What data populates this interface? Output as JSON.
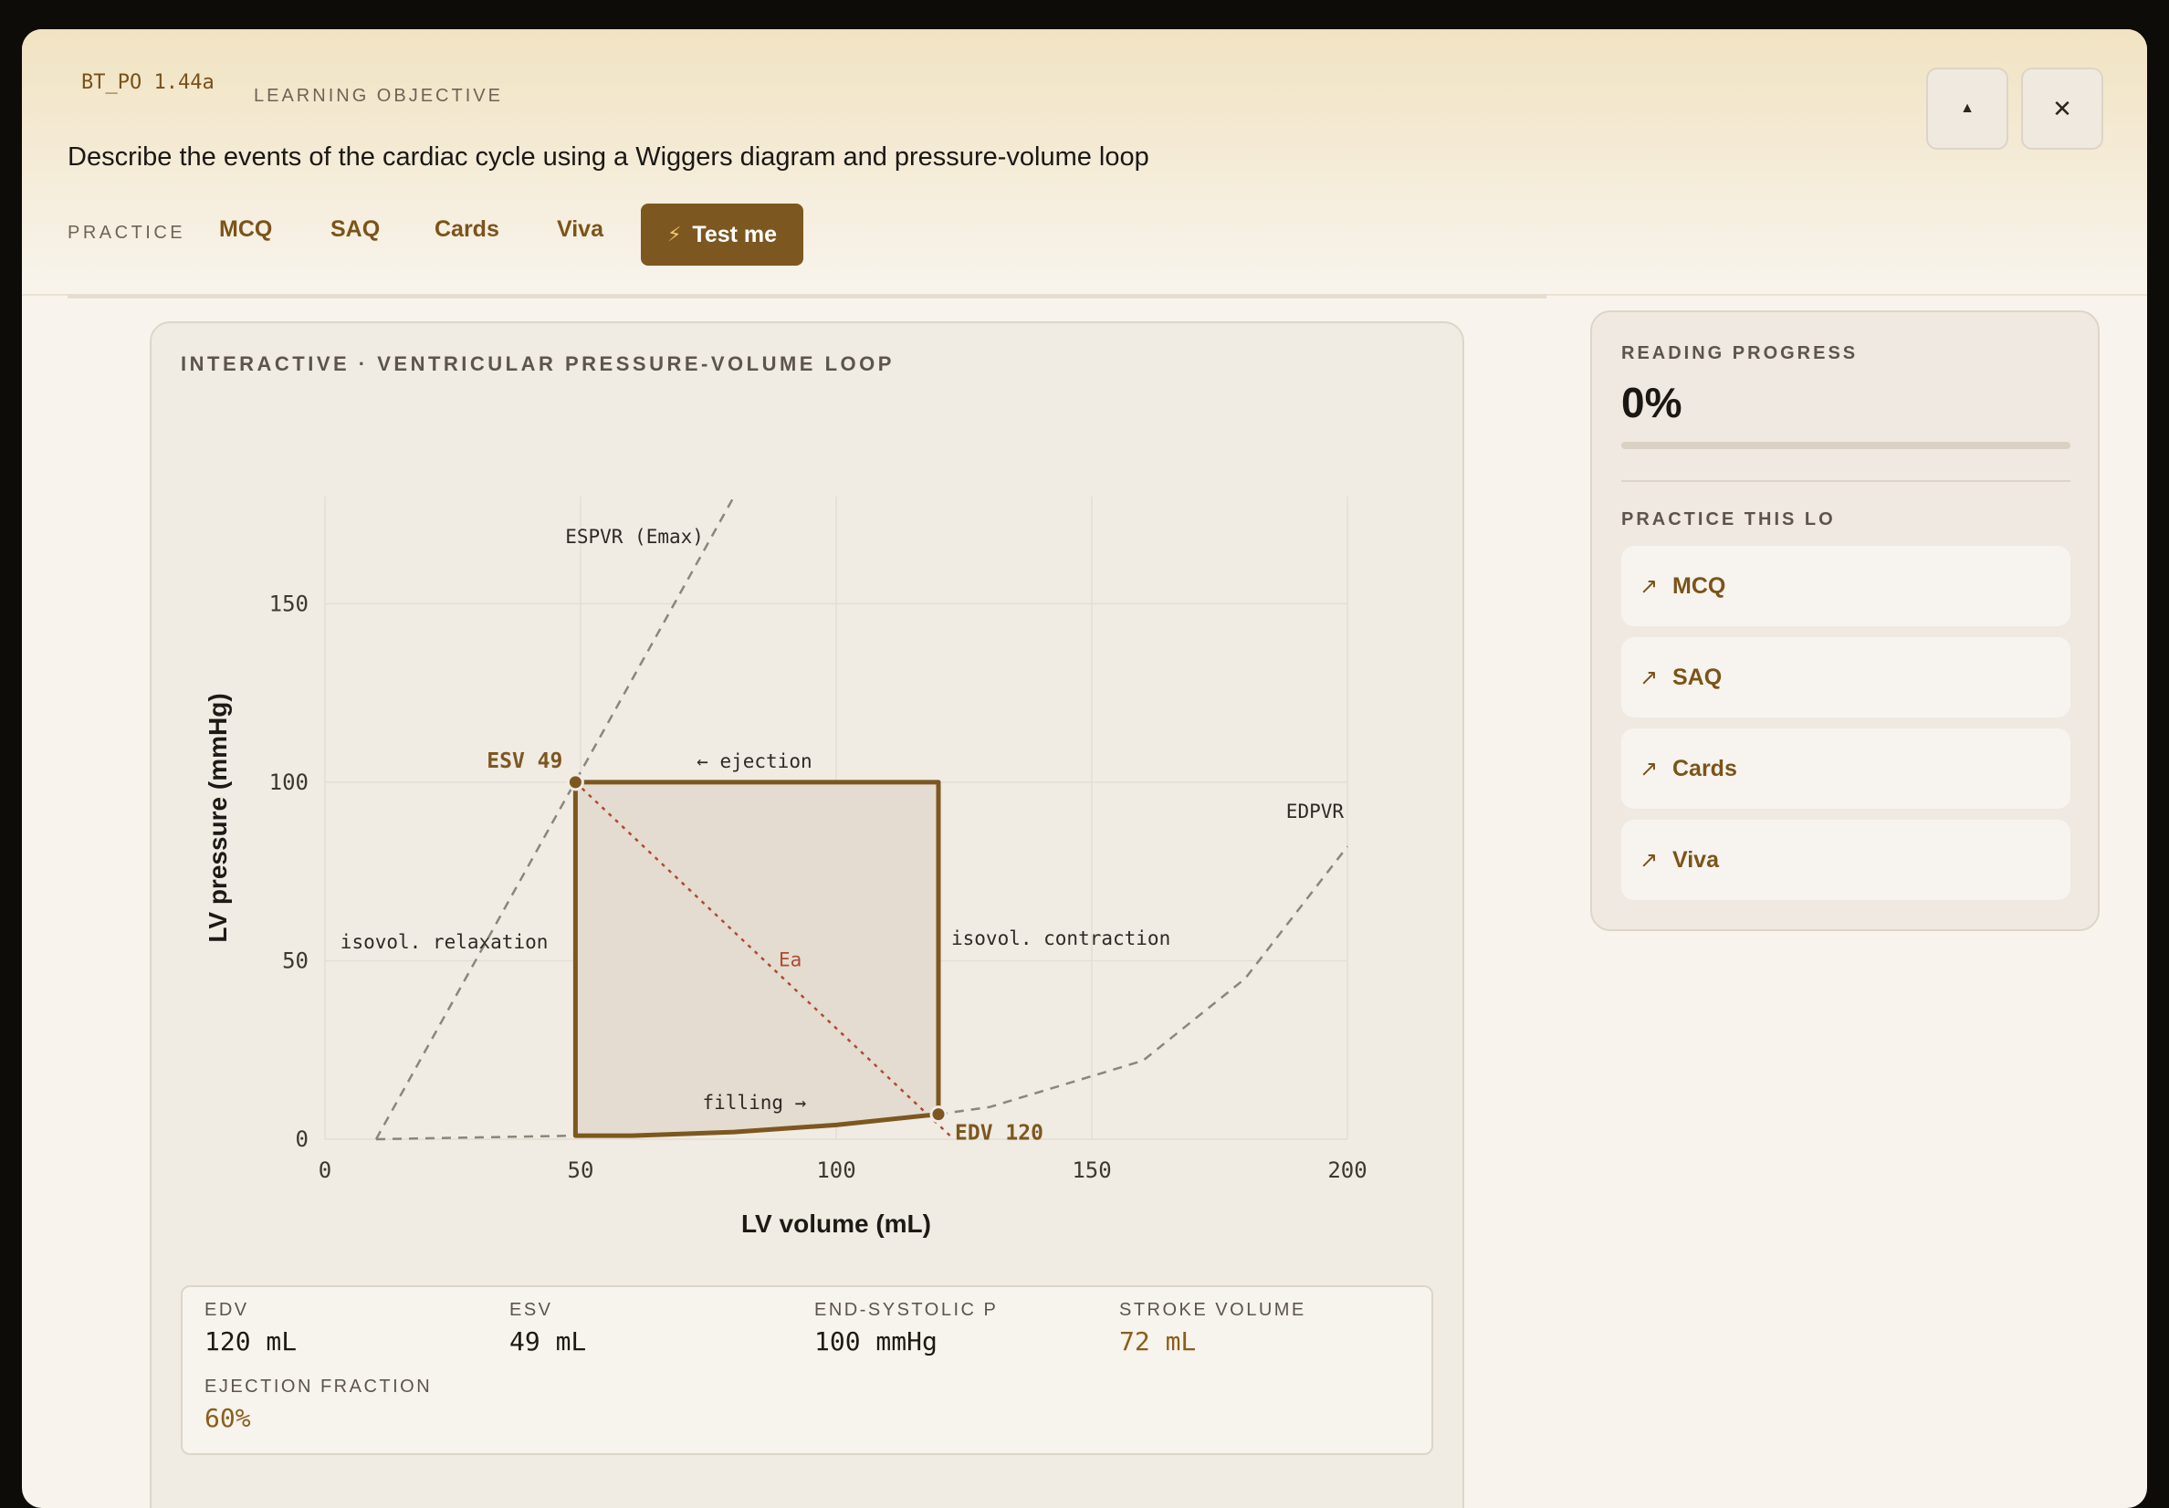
{
  "header": {
    "code": "BT_PO 1.44a",
    "kicker": "LEARNING OBJECTIVE",
    "title": "Describe the events of the cardiac cycle using a Wiggers diagram and pressure-volume loop",
    "practice_label": "PRACTICE",
    "practice_links": [
      "MCQ",
      "SAQ",
      "Cards",
      "Viva"
    ],
    "test_button": "Test me",
    "icons": {
      "test": "lightning-icon",
      "collapse": "triangle-up-icon",
      "close": "close-icon"
    },
    "collapse_glyph": "▲",
    "close_glyph": "✕",
    "bolt_glyph": "⚡"
  },
  "card": {
    "title": "INTERACTIVE · VENTRICULAR PRESSURE-VOLUME LOOP"
  },
  "chart_data": {
    "type": "line",
    "title": "",
    "xlabel": "LV volume (mL)",
    "ylabel": "LV pressure (mmHg)",
    "xlim": [
      0,
      200
    ],
    "ylim": [
      0,
      180
    ],
    "xticks": [
      0,
      50,
      100,
      150,
      200
    ],
    "yticks": [
      0,
      50,
      100,
      150
    ],
    "grid": true,
    "loop": [
      [
        49,
        100
      ],
      [
        120,
        100
      ],
      [
        120,
        7
      ],
      [
        100,
        4
      ],
      [
        80,
        2
      ],
      [
        60,
        1
      ],
      [
        49,
        1
      ],
      [
        49,
        100
      ]
    ],
    "espvr": [
      [
        10,
        0
      ],
      [
        80,
        180
      ]
    ],
    "edpvr": [
      [
        120,
        7
      ],
      [
        130,
        9
      ],
      [
        160,
        22
      ],
      [
        180,
        45
      ],
      [
        200,
        82
      ]
    ],
    "baseline": [
      [
        10,
        0
      ],
      [
        49,
        1
      ]
    ],
    "ea_line": [
      [
        49,
        100
      ],
      [
        123,
        0
      ]
    ],
    "points": [
      {
        "label": "ESV 49",
        "x": 49,
        "y": 100
      },
      {
        "label": "EDV 120",
        "x": 120,
        "y": 7
      }
    ],
    "annotations": [
      "ESPVR (Emax)",
      "← ejection",
      "isovol. relaxation",
      "isovol. contraction",
      "Ea",
      "filling →",
      "EDPVR"
    ],
    "colors": {
      "loop": "#7d5720",
      "fill": "#e4dcd0",
      "ea": "#b04a30",
      "guide": "#8c8679",
      "grid": "#e4ded5"
    }
  },
  "stats": [
    {
      "label": "EDV",
      "value": "120 mL",
      "accent": false
    },
    {
      "label": "ESV",
      "value": "49 mL",
      "accent": false
    },
    {
      "label": "END-SYSTOLIC P",
      "value": "100 mmHg",
      "accent": false
    },
    {
      "label": "STROKE VOLUME",
      "value": "72 mL",
      "accent": true
    },
    {
      "label": "EJECTION FRACTION",
      "value": "60%",
      "accent": true
    }
  ],
  "side": {
    "progress_label": "READING PROGRESS",
    "progress_text": "0%",
    "progress_value": 0,
    "practice_label": "PRACTICE THIS LO",
    "items": [
      "MCQ",
      "SAQ",
      "Cards",
      "Viva"
    ],
    "item_icon": "arrow-up-right-icon",
    "arrow_glyph": "↗"
  }
}
